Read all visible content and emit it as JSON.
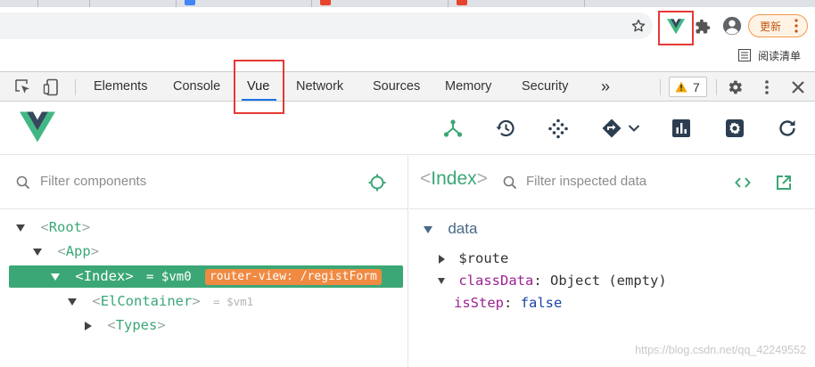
{
  "browser": {
    "update_label": "更新",
    "reading_list_label": "阅读清单"
  },
  "devtools": {
    "tabs": [
      "Elements",
      "Console",
      "Vue",
      "Network",
      "Sources",
      "Memory",
      "Security"
    ],
    "active_tab": "Vue",
    "more_tabs_label": "»",
    "warning_count": "7"
  },
  "vue_panel": {
    "nav_icons": [
      "component-tree-icon",
      "history-icon",
      "vuex-icon",
      "routing-icon",
      "performance-icon",
      "settings-icon",
      "refresh-icon"
    ],
    "filter_components_placeholder": "Filter components",
    "filter_data_placeholder": "Filter inspected data",
    "tree": [
      {
        "open": "<",
        "name": "Root",
        "close": ">"
      },
      {
        "open": "<",
        "name": "App",
        "close": ">"
      },
      {
        "open": "<",
        "name": "Index",
        "close": ">",
        "vm": "= $vm0",
        "badge": "router-view: /registForm"
      },
      {
        "open": "<",
        "name": "ElContainer",
        "close": ">",
        "vm": "= $vm1"
      },
      {
        "open": "<",
        "name": "Types",
        "close": ">"
      }
    ],
    "inspected": {
      "open": "<",
      "name": "Index",
      "close": ">"
    },
    "data": {
      "heading": "data",
      "rows": [
        {
          "key": "$route",
          "sep": "",
          "value": ""
        },
        {
          "key": "classData",
          "sep": ":",
          "value": "Object (empty)"
        },
        {
          "key": "isStep",
          "sep": ":",
          "value": "false"
        }
      ]
    }
  },
  "watermark": "https://blog.csdn.net/qq_42249552",
  "colors": {
    "vue_green": "#3ba776",
    "selected_row": "#3ba776",
    "badge_orange": "#f08a42",
    "highlight_red": "#e53935",
    "devtools_blue": "#1a73e8"
  }
}
